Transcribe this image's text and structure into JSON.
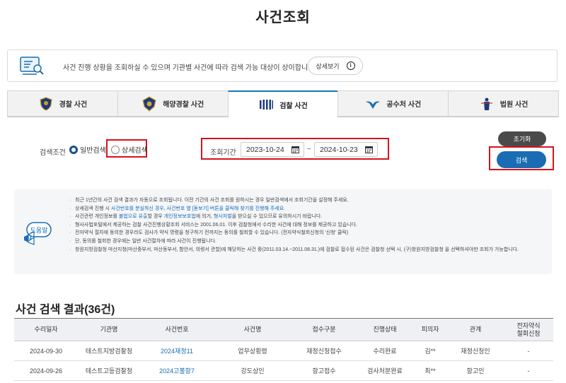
{
  "page": {
    "title": "사건조회"
  },
  "banner": {
    "text": "사건 진행 상황을 조회하실 수 있으며 기관별 사건에 따라 검색 가능 대상이 상이합니다.",
    "detail_button": "상세보기",
    "detail_icon": "info-circle-icon"
  },
  "tabs": [
    {
      "label": "경찰 사건",
      "icon": "police-badge-icon",
      "active": false
    },
    {
      "label": "해양경찰 사건",
      "icon": "coast-guard-badge-icon",
      "active": false
    },
    {
      "label": "검찰 사건",
      "icon": "prosecution-logo-icon",
      "active": true
    },
    {
      "label": "공수처 사건",
      "icon": "cio-logo-icon",
      "active": false
    },
    {
      "label": "법원 사건",
      "icon": "court-logo-icon",
      "active": false
    }
  ],
  "search": {
    "condition_label": "검색조건",
    "option_general": "일반검색",
    "option_detail": "상세검색",
    "selected": "일반검색",
    "period_label": "조회기간",
    "date_from": "2023-10-24",
    "date_to": "2024-10-23",
    "tilde": "~",
    "reset_button": "초기화",
    "search_button": "검색"
  },
  "help": {
    "badge": "도움말",
    "items": [
      {
        "text": "최근 1년간의 사건 검색 결과가 자동으로 조회됩니다. 이전 기간의 사건 조회를 원하시는 경우 일반검색에서 조회기간을 설정해 주세요."
      },
      {
        "pre": "상세검색 진행 시 ",
        "blue": "사건번호를 분실하신 경우, 사건번호 옆 [돋보기] 버튼을 클릭해 찾기를 진행해 주세요.",
        "post": ""
      },
      {
        "pre": "사건관련 개인정보를 ",
        "blue": "불법으로 유출",
        "mid": "할 경우 ",
        "blue2": "개인정보보호법",
        "mid2": "에 의거, ",
        "blue3": "형사처벌",
        "post": "을 받으실 수 있으므로 유의하시기 바랍니다."
      },
      {
        "text": "형사사법포털에서 제공하는 검찰 사건진행상황조회 서비스는 2001.06.01. 이후 검찰청에서 수리한 사건에 대해 정보를 제공하고 있습니다."
      },
      {
        "text": "전자약식 절차에 동의한 경우라도 검사가 약식 명령을 청구하기 전까지는 동의를 철회할 수 있습니다. (전자약식철회신청의 '신청' 클릭)"
      },
      {
        "text": "단, 동의를 철회한 경우에는 일반 사건절차에 따라 사건이 진행됩니다."
      },
      {
        "text": "창원지방검찰청 마산지청(마산중부서, 마산동부서, 함안서, 의령서 관할)에 해당하는 사건 중(2011.03.14.~2011.08.31.)에 검찰로 접수된 사건은 검찰청 선택 시, (구)창원지방검찰청 을 선택하셔야만 조회가 가능합니다."
      }
    ]
  },
  "results": {
    "title": "사건 검색 결과(36건)",
    "columns": [
      "수리일자",
      "기관명",
      "사건번호",
      "사건명",
      "접수구분",
      "진행상태",
      "피의자",
      "관계",
      "전자약식\n철회신청"
    ],
    "rows": [
      [
        "2024-09-30",
        "테스트지방검찰청",
        "2024재정11",
        "업무상횡령",
        "재정신청접수",
        "수리완료",
        "김**",
        "재정신청인",
        "-"
      ],
      [
        "2024-09-26",
        "테스트고등검찰청",
        "2024고불항7",
        "강도상인",
        "항고접수",
        "검사처분완료",
        "최**",
        "항고인",
        "-"
      ]
    ]
  }
}
